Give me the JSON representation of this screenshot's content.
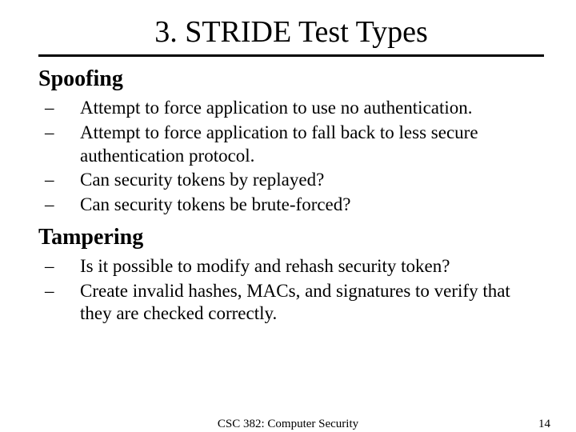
{
  "title": "3. STRIDE Test Types",
  "sections": [
    {
      "heading": "Spoofing",
      "items": [
        "Attempt to force application to use no authentication.",
        "Attempt to force application to fall back to less secure authentication protocol.",
        "Can security tokens by replayed?",
        "Can security tokens be brute-forced?"
      ]
    },
    {
      "heading": "Tampering",
      "items": [
        "Is it possible to modify and rehash security token?",
        "Create invalid hashes, MACs, and signatures to verify that they are checked correctly."
      ]
    }
  ],
  "footer": {
    "center": "CSC 382: Computer Security",
    "page": "14"
  }
}
